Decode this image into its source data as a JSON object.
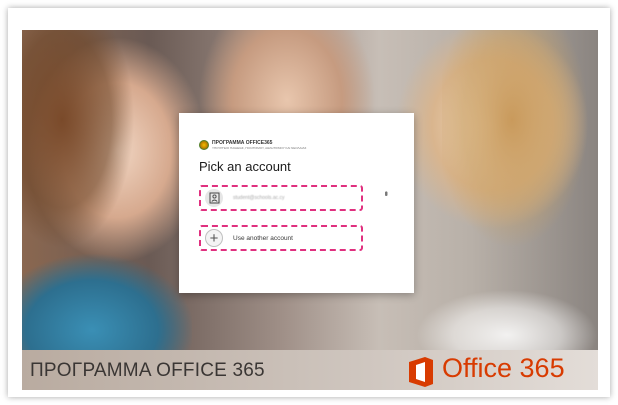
{
  "background": {
    "banner_text": "ΠΡΟΓΡΑΜΜΑ OFFICE 365",
    "product_name": "Office 365",
    "accent_color": "#d83b01"
  },
  "dialog": {
    "brand_title": "ΠΡΟΓΡΑΜΜΑ OFFICE365",
    "brand_subtitle": "ΥΠΟΥΡΓΕΙΟ ΠΑΙΔΕΙΑΣ, ΠΟΛΙΤΙΣΜΟΥ, ΑΘΛΗΤΙΣΜΟΥ ΚΑΙ ΝΕΟΛΑΙΑΣ",
    "heading": "Pick an account",
    "accounts": [
      {
        "email": "student@schools.ac.cy",
        "avatar_icon": "contact-card-icon"
      }
    ],
    "more_options_icon": "vertical-ellipsis-icon",
    "use_another_label": "Use another account",
    "use_another_icon": "plus-icon",
    "highlight_color": "#e0307f"
  }
}
